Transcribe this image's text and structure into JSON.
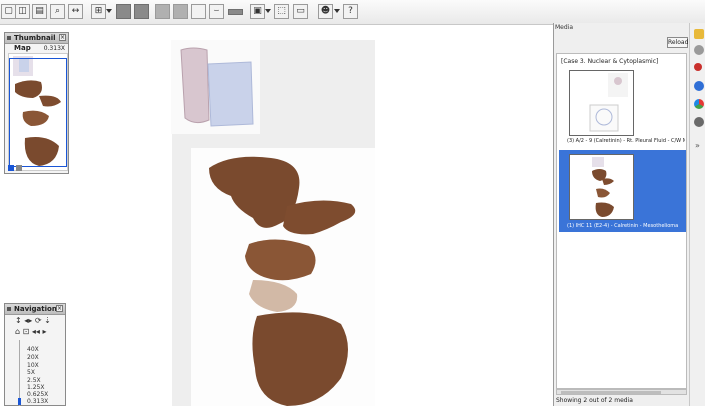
{
  "thumbnail_map": {
    "title": "Thumbnail Map",
    "zoom": "0.313X"
  },
  "navigation": {
    "title": "Navigation",
    "zoom_levels": [
      "40X",
      "20X",
      "10X",
      "5X",
      "2.5X",
      "1.25X",
      "0.625X",
      "0.313X"
    ],
    "current_zoom_fraction": 1.0
  },
  "media": {
    "title": "Media",
    "reload_label": "Reload",
    "case_label": "[Case 3. Nuclear & Cytoplasmic]",
    "items": [
      {
        "caption": "(3) A/2 - 9  (Calretinin) - Rt. Pleural Fluid - C/W M",
        "selected": false
      },
      {
        "caption": "(1) IHC 11     (E2-4) - Calretinin - Mesothelioma",
        "selected": true
      }
    ],
    "status": "Showing 2 out of 2 media"
  },
  "toolbar": {
    "help_label": "?"
  },
  "colors": {
    "accent": "#3a74d8",
    "stain_brown": "#7a4a2e",
    "slide_bg": "#eeeeee"
  }
}
